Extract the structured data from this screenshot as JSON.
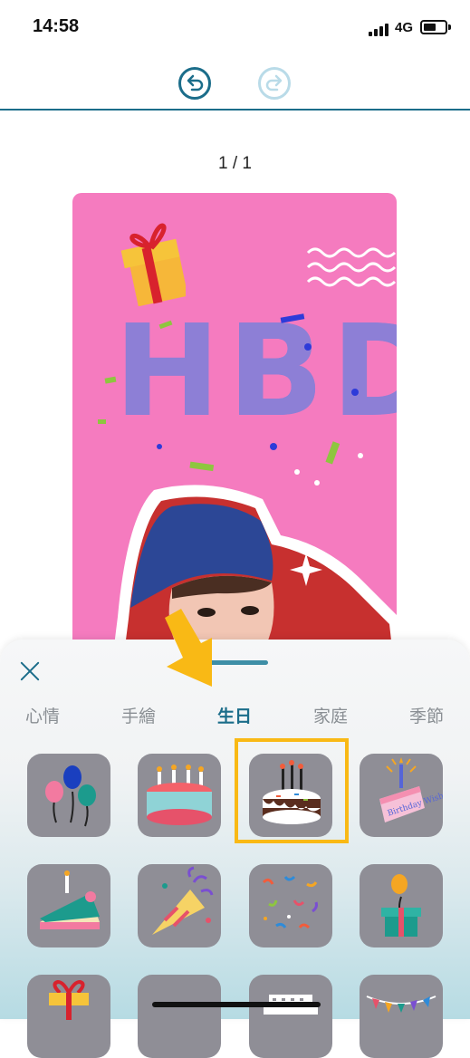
{
  "status_bar": {
    "time": "14:58",
    "network": "4G",
    "battery_level": 0.6
  },
  "toolbar": {
    "undo_icon": "undo-icon",
    "redo_icon": "redo-icon",
    "redo_enabled": false
  },
  "page_counter": "1 / 1",
  "card": {
    "headline": "HBD",
    "background": "#f57bbf"
  },
  "sticker_panel": {
    "tabs": [
      {
        "label": "心情"
      },
      {
        "label": "手繪"
      },
      {
        "label": "生日",
        "active": true
      },
      {
        "label": "家庭"
      },
      {
        "label": "季節"
      }
    ],
    "stickers": [
      {
        "icon": "balloons-icon"
      },
      {
        "icon": "cake-candles-icon"
      },
      {
        "icon": "sprinkle-cake-icon",
        "highlighted": true
      },
      {
        "icon": "birthday-wishes-cake-icon",
        "text": "Birthday Wishes"
      },
      {
        "icon": "cake-slice-icon"
      },
      {
        "icon": "party-horn-icon"
      },
      {
        "icon": "confetti-icon"
      },
      {
        "icon": "balloon-gift-icon"
      },
      {
        "icon": "gift-icon"
      },
      {
        "icon": "blank-sticker-icon"
      },
      {
        "icon": "happy-birthday-text-icon"
      },
      {
        "icon": "bunting-icon"
      }
    ]
  },
  "colors": {
    "accent": "#1b6d8a",
    "highlight": "#f9b915",
    "tile": "#8f8e96"
  }
}
